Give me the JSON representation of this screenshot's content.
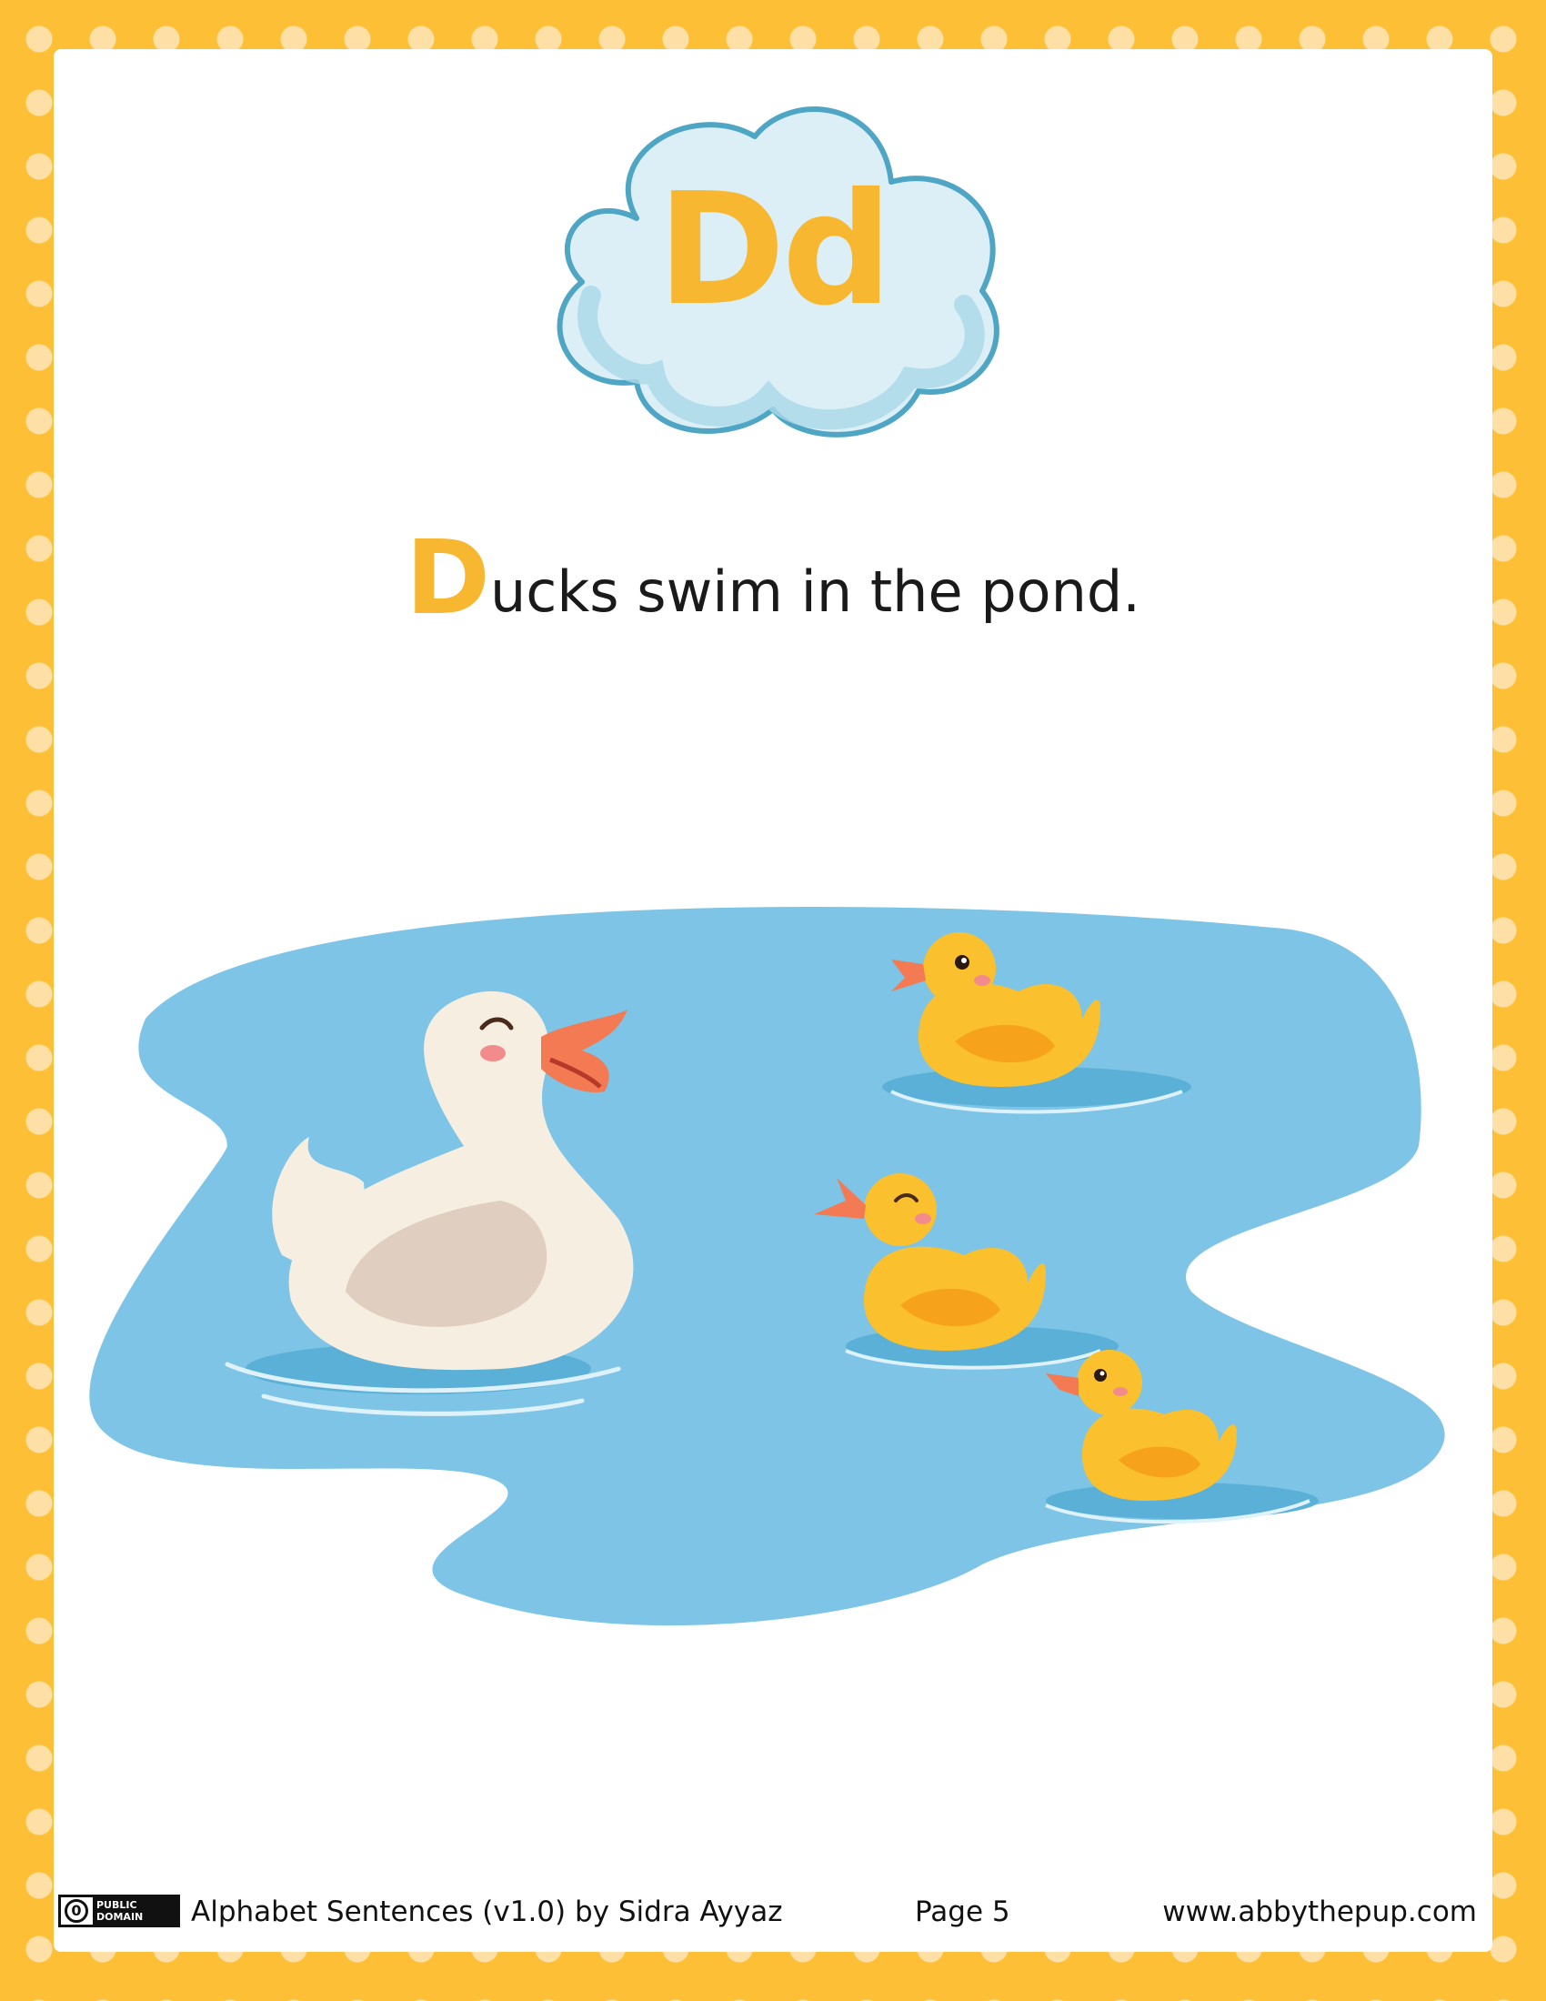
{
  "header": {
    "letter_pair": "Dd"
  },
  "sentence": {
    "first_letter": "D",
    "rest": "ucks swim in the pond."
  },
  "illustration": {
    "subjects": [
      "mother-duck",
      "duckling",
      "duckling",
      "duckling",
      "pond"
    ]
  },
  "footer": {
    "license_icon": "public-domain-badge",
    "license_zero": "0",
    "license_line1": "PUBLIC",
    "license_line2": "DOMAIN",
    "credit": "Alphabet Sentences (v1.0) by Sidra Ayyaz",
    "page_label": "Page 5",
    "website": "www.abbythepup.com"
  },
  "colors": {
    "frame": "#FDBF35",
    "dots": "#FEE0A6",
    "accent_letter": "#F7B731",
    "cloud_fill": "#DCEFF6",
    "cloud_stroke": "#4FA6C4",
    "pond": "#7DC4E6",
    "duckling": "#FBC02D",
    "beak": "#F37A52"
  }
}
